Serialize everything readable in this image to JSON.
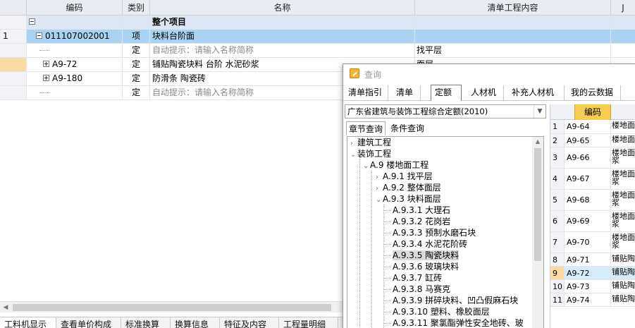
{
  "grid": {
    "columns": [
      "编码",
      "类别",
      "名称",
      "清单工程内容",
      "J"
    ],
    "rows": [
      {
        "num": "",
        "code": "",
        "category": "",
        "name": "整个项目",
        "content": "",
        "type": "group",
        "toggle": "minus"
      },
      {
        "num": "1",
        "code": "011107002001",
        "category": "项",
        "name": "块料台阶面",
        "content": "",
        "type": "selected",
        "toggle": "minus"
      },
      {
        "num": "",
        "code": "",
        "category": "定",
        "name": "自动提示：请输入名称简称",
        "content": "找平层",
        "type": "hint",
        "toggle": "line"
      },
      {
        "num": "",
        "code": "A9-72",
        "category": "定",
        "name": "铺贴陶瓷块料 台阶 水泥砂浆",
        "content": "面层",
        "type": "mark",
        "toggle": "plus"
      },
      {
        "num": "",
        "code": "A9-180",
        "category": "定",
        "name": "防滑条 陶瓷砖",
        "content": "",
        "type": "normal",
        "toggle": "plus"
      },
      {
        "num": "",
        "code": "",
        "category": "定",
        "name": "自动提示：请输入名称简称",
        "content": "",
        "type": "hint",
        "toggle": "line"
      }
    ]
  },
  "bottom_tabs": [
    "工料机显示",
    "查看单价构成",
    "标准换算",
    "换算信息",
    "特征及内容",
    "工程量明细"
  ],
  "dialog": {
    "title": "查询",
    "tabs": [
      "清单指引",
      "清单",
      "定额",
      "人材机",
      "补充人材机",
      "我的云数据"
    ],
    "active_tab": "定额",
    "library": "广东省建筑与装饰工程综合定额(2010)",
    "search_tabs": [
      "章节查询",
      "条件查询"
    ],
    "tree": [
      {
        "label": "建筑工程",
        "toggle": "›"
      },
      {
        "label": "装饰工程",
        "toggle": "⌄"
      },
      {
        "label": "A.9 楼地面工程",
        "toggle": "⌄"
      },
      {
        "label": "A.9.1 找平层",
        "toggle": "›"
      },
      {
        "label": "A.9.2 整体面层",
        "toggle": "›"
      },
      {
        "label": "A.9.3 块料面层",
        "toggle": "⌄"
      },
      {
        "label": "A.9.3.1 大理石",
        "toggle": ""
      },
      {
        "label": "A.9.3.2 花岗岩",
        "toggle": ""
      },
      {
        "label": "A.9.3.3 预制水磨石块",
        "toggle": ""
      },
      {
        "label": "A.9.3.4 水泥花阶砖",
        "toggle": ""
      },
      {
        "label": "A.9.3.5 陶瓷块料",
        "toggle": ""
      },
      {
        "label": "A.9.3.6 玻璃块料",
        "toggle": ""
      },
      {
        "label": "A.9.3.7 缸砖",
        "toggle": ""
      },
      {
        "label": "A.9.3.8 马赛克",
        "toggle": ""
      },
      {
        "label": "A.9.3.9 拼碎块料、凹凸假麻石块",
        "toggle": ""
      },
      {
        "label": "A.9.3.10 塑料、橡胶面层",
        "toggle": ""
      },
      {
        "label": "A.9.3.11 聚氯酯弹性安全地砖、玻",
        "toggle": ""
      }
    ],
    "list_header_code": "编码",
    "list": [
      {
        "num": "1",
        "code": "A9-64",
        "name": "楼地面"
      },
      {
        "num": "2",
        "code": "A9-65",
        "name": "楼地面"
      },
      {
        "num": "3",
        "code": "A9-66",
        "name": "楼地面浆"
      },
      {
        "num": "4",
        "code": "A9-67",
        "name": "楼地面浆"
      },
      {
        "num": "5",
        "code": "A9-68",
        "name": "楼地面浆"
      },
      {
        "num": "6",
        "code": "A9-69",
        "name": "楼地面浆"
      },
      {
        "num": "7",
        "code": "A9-70",
        "name": "楼地面浆"
      },
      {
        "num": "8",
        "code": "A9-71",
        "name": "铺贴陶"
      },
      {
        "num": "9",
        "code": "A9-72",
        "name": "铺贴陶"
      },
      {
        "num": "10",
        "code": "A9-73",
        "name": "铺贴陶"
      },
      {
        "num": "11",
        "code": "A9-74",
        "name": "铺贴陶"
      }
    ]
  }
}
